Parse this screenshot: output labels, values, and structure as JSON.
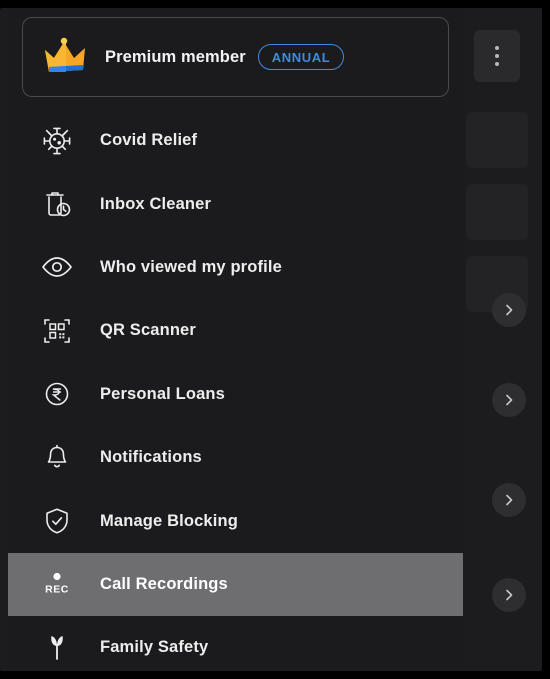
{
  "theme": {
    "background": "#000000",
    "menu_background": "#1b1b1d",
    "app_background": "#1c1c1e",
    "text": "#ededed",
    "accent_blue": "#3f8ae0",
    "selected_row": "#6e6e70"
  },
  "premium": {
    "icon": "crown-icon",
    "label": "Premium member",
    "badge": "ANNUAL"
  },
  "menu": {
    "items": [
      {
        "icon": "virus-icon",
        "label": "Covid Relief",
        "selected": false
      },
      {
        "icon": "inbox-clean-icon",
        "label": "Inbox Cleaner",
        "selected": false
      },
      {
        "icon": "eye-icon",
        "label": "Who viewed my profile",
        "selected": false
      },
      {
        "icon": "qr-code-icon",
        "label": "QR Scanner",
        "selected": false
      },
      {
        "icon": "rupee-coin-icon",
        "label": "Personal Loans",
        "selected": false
      },
      {
        "icon": "bell-icon",
        "label": "Notifications",
        "selected": false
      },
      {
        "icon": "shield-icon",
        "label": "Manage Blocking",
        "selected": false
      },
      {
        "icon": "call-recording-icon",
        "label": "Call Recordings",
        "selected": true
      },
      {
        "icon": "family-safety-icon",
        "label": "Family Safety",
        "selected": false
      }
    ]
  },
  "background_app": {
    "overflow_icon": "more-vertical-icon",
    "chevron_icon": "chevron-right-icon",
    "chevron_count": 4
  }
}
